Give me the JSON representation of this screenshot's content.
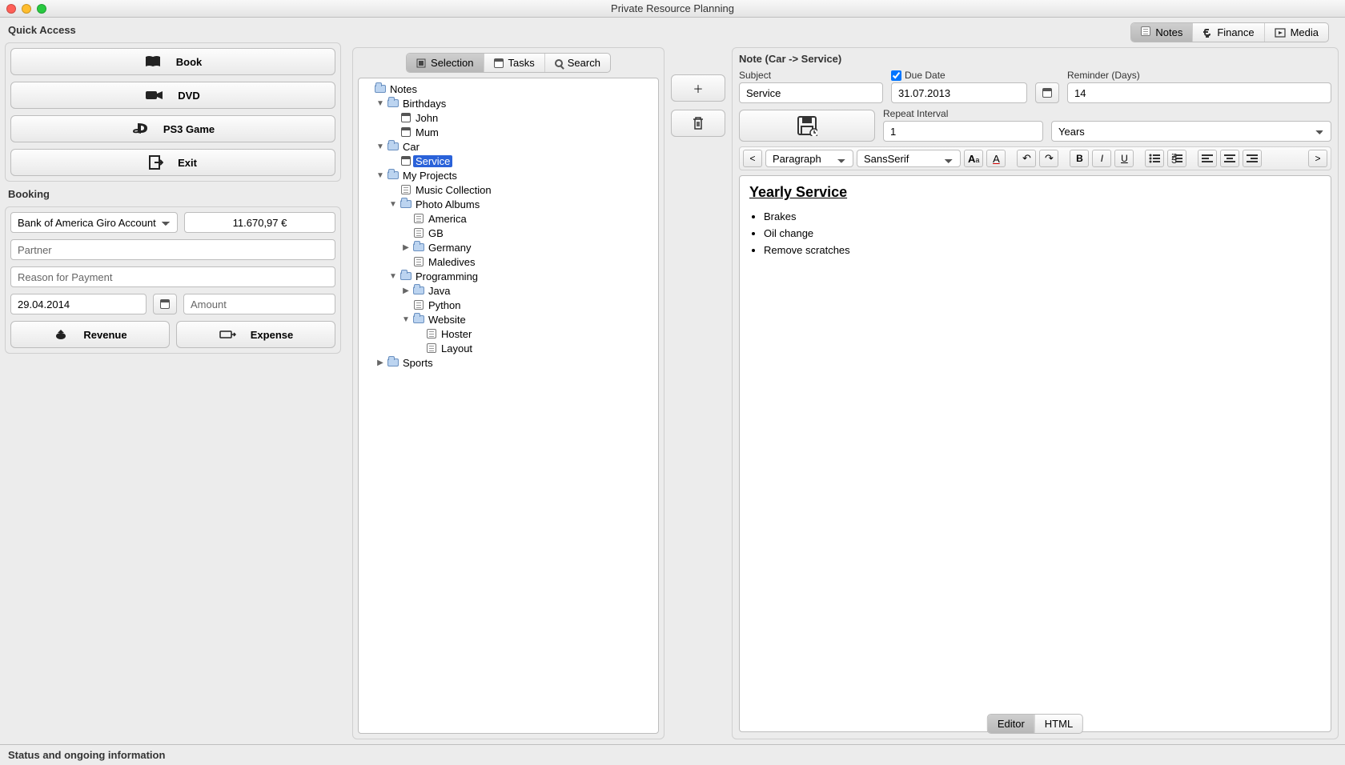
{
  "window": {
    "title": "Private Resource Planning"
  },
  "quickAccess": {
    "label": "Quick Access",
    "buttons": {
      "book": "Book",
      "dvd": "DVD",
      "ps3": "PS3 Game",
      "exit": "Exit"
    }
  },
  "booking": {
    "label": "Booking",
    "account": "Bank of America Giro Account",
    "balance": "11.670,97 €",
    "partner_ph": "Partner",
    "reason_ph": "Reason for Payment",
    "date": "29.04.2014",
    "amount_ph": "Amount",
    "revenue": "Revenue",
    "expense": "Expense"
  },
  "mainTabs": {
    "notes": "Notes",
    "finance": "Finance",
    "media": "Media"
  },
  "treeTabs": {
    "selection": "Selection",
    "tasks": "Tasks",
    "search": "Search"
  },
  "tree": [
    {
      "indent": 0,
      "arrow": "",
      "icon": "folder",
      "label": "Notes"
    },
    {
      "indent": 1,
      "arrow": "down",
      "icon": "folder",
      "label": "Birthdays"
    },
    {
      "indent": 2,
      "arrow": "",
      "icon": "cal",
      "label": "John"
    },
    {
      "indent": 2,
      "arrow": "",
      "icon": "cal",
      "label": "Mum"
    },
    {
      "indent": 1,
      "arrow": "down",
      "icon": "folder",
      "label": "Car"
    },
    {
      "indent": 2,
      "arrow": "",
      "icon": "cal",
      "label": "Service",
      "selected": true
    },
    {
      "indent": 1,
      "arrow": "down",
      "icon": "folder",
      "label": "My Projects"
    },
    {
      "indent": 2,
      "arrow": "",
      "icon": "note",
      "label": "Music Collection"
    },
    {
      "indent": 2,
      "arrow": "down",
      "icon": "folder",
      "label": "Photo Albums"
    },
    {
      "indent": 3,
      "arrow": "",
      "icon": "note",
      "label": "America"
    },
    {
      "indent": 3,
      "arrow": "",
      "icon": "note",
      "label": "GB"
    },
    {
      "indent": 3,
      "arrow": "right",
      "icon": "folder",
      "label": "Germany"
    },
    {
      "indent": 3,
      "arrow": "",
      "icon": "note",
      "label": "Maledives"
    },
    {
      "indent": 2,
      "arrow": "down",
      "icon": "folder",
      "label": "Programming"
    },
    {
      "indent": 3,
      "arrow": "right",
      "icon": "folder",
      "label": "Java"
    },
    {
      "indent": 3,
      "arrow": "",
      "icon": "note",
      "label": "Python"
    },
    {
      "indent": 3,
      "arrow": "down",
      "icon": "folder",
      "label": "Website"
    },
    {
      "indent": 4,
      "arrow": "",
      "icon": "note",
      "label": "Hoster"
    },
    {
      "indent": 4,
      "arrow": "",
      "icon": "note",
      "label": "Layout"
    },
    {
      "indent": 1,
      "arrow": "right",
      "icon": "folder",
      "label": "Sports"
    }
  ],
  "note": {
    "header": "Note (Car -> Service)",
    "subjectLabel": "Subject",
    "subject": "Service",
    "dueDateLabel": "Due Date",
    "dueDate": "31.07.2013",
    "reminderLabel": "Reminder (Days)",
    "reminder": "14",
    "repeatLabel": "Repeat Interval",
    "repeatValue": "1",
    "repeatUnit": "Years",
    "paragraph": "Paragraph",
    "font": "SansSerif",
    "title": "Yearly Service",
    "items": [
      "Brakes",
      "Oil change",
      "Remove scratches"
    ],
    "editorTab": "Editor",
    "htmlTab": "HTML",
    "lt": "<",
    "gt": ">"
  },
  "status": "Status and ongoing information"
}
